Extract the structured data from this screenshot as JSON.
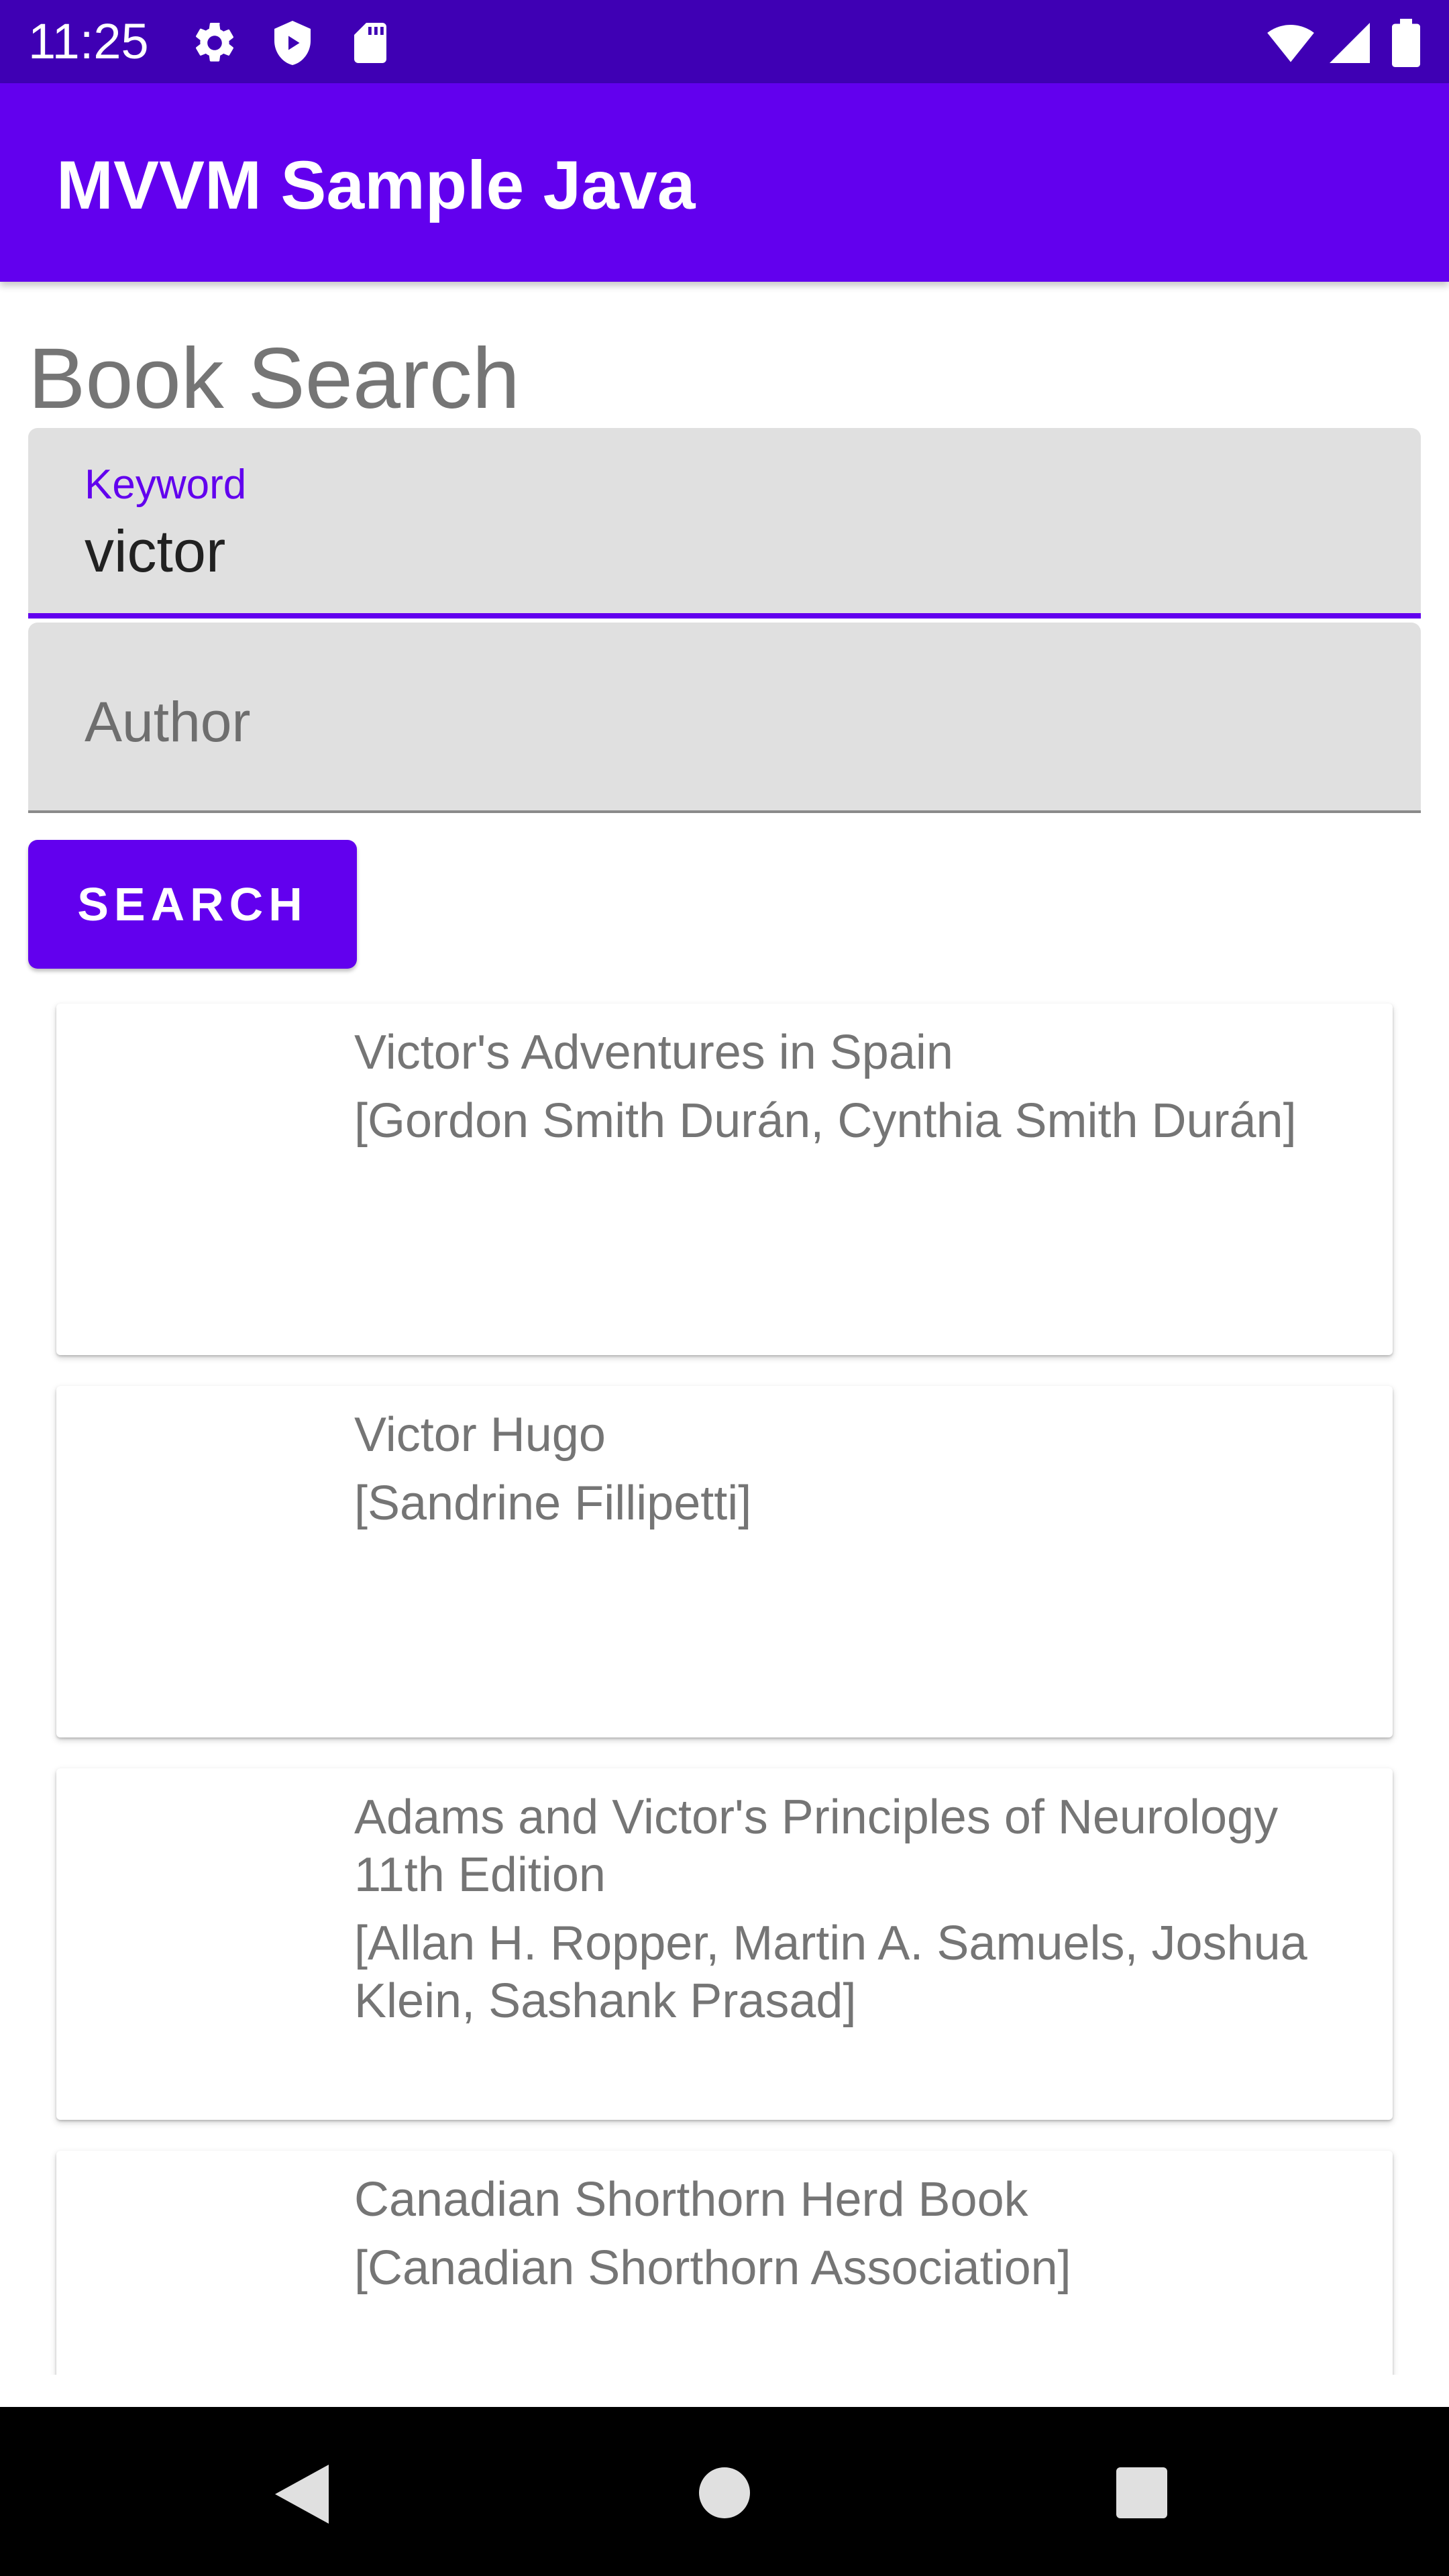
{
  "status_bar": {
    "time": "11:25",
    "icons_left": [
      "gear-icon",
      "shield-icon",
      "sd-card-icon"
    ],
    "icons_right": [
      "wifi-icon",
      "signal-icon",
      "battery-icon"
    ]
  },
  "app_bar": {
    "title": "MVVM Sample Java"
  },
  "main": {
    "heading": "Book Search",
    "keyword_field": {
      "label": "Keyword",
      "value": "victor"
    },
    "author_field": {
      "placeholder": "Author",
      "value": ""
    },
    "search_button": "SEARCH"
  },
  "results": [
    {
      "title": "Victor's Adventures in Spain",
      "authors": "[Gordon Smith Durán, Cynthia Smith Durán]"
    },
    {
      "title": "Victor Hugo",
      "authors": "[Sandrine Fillipetti]"
    },
    {
      "title": "Adams and Victor's Principles of Neurology 11th Edition",
      "authors": "[Allan H. Ropper, Martin A. Samuels, Joshua Klein, Sashank Prasad]"
    },
    {
      "title": "Canadian Shorthorn Herd Book",
      "authors": "[Canadian Shorthorn Association]"
    }
  ],
  "nav_bar": {
    "buttons": [
      "back-icon",
      "home-icon",
      "recents-icon"
    ]
  },
  "colors": {
    "status_bar": "#3f00b4",
    "primary": "#6200ee",
    "field_background": "#e0e0e0",
    "secondary_text": "#757575",
    "nav_bar": "#000000"
  }
}
